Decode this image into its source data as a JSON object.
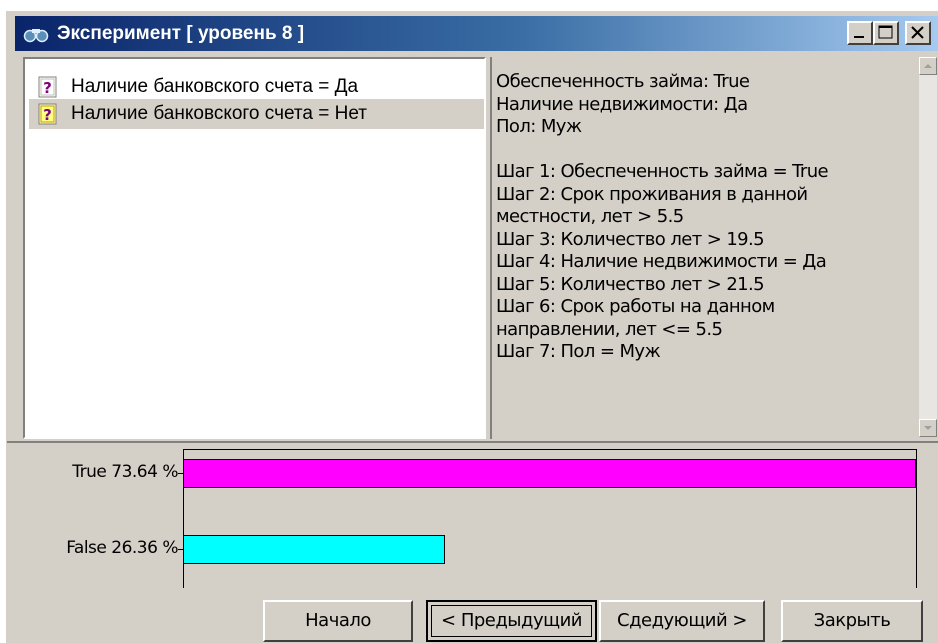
{
  "window": {
    "title": "Эксперимент [ уровень 8 ]"
  },
  "list": {
    "items": [
      {
        "label": "Наличие банковского счета = Да",
        "selected": false
      },
      {
        "label": "Наличие банковского счета = Нет",
        "selected": true
      }
    ]
  },
  "info": {
    "text": "Обеспеченность займа: True\nНаличие недвижимости: Да\nПол: Муж\n\n Шаг 1: Обеспеченность займа = True\n Шаг 2: Срок проживания в данной местности, лет > 5.5\n Шаг 3: Количество лет > 19.5\n Шаг 4: Наличие недвижимости = Да\n Шаг 5: Количество лет > 21.5\n Шаг 6: Срок работы на данном направлении, лет <= 5.5\n Шаг 7: Пол = Муж"
  },
  "chart_data": {
    "type": "bar",
    "orientation": "horizontal",
    "categories": [
      "True",
      "False"
    ],
    "values": [
      73.64,
      26.36
    ],
    "tick_labels": [
      "True 73.64 %",
      "False 26.36 %"
    ],
    "colors": [
      "#ff00ff",
      "#00ffff"
    ],
    "xlim": [
      0,
      73.64
    ]
  },
  "buttons": {
    "start": "Начало",
    "prev": "< Предыдущий",
    "next": "Сдедующий >",
    "close": "Закрыть"
  },
  "icons": {
    "title": "binoculars-icon",
    "list_item": "question-mark-icon",
    "minimize": "minimize-icon",
    "maximize": "maximize-icon",
    "close": "close-icon",
    "scroll_up": "arrow-up-icon",
    "scroll_down": "arrow-down-icon"
  }
}
